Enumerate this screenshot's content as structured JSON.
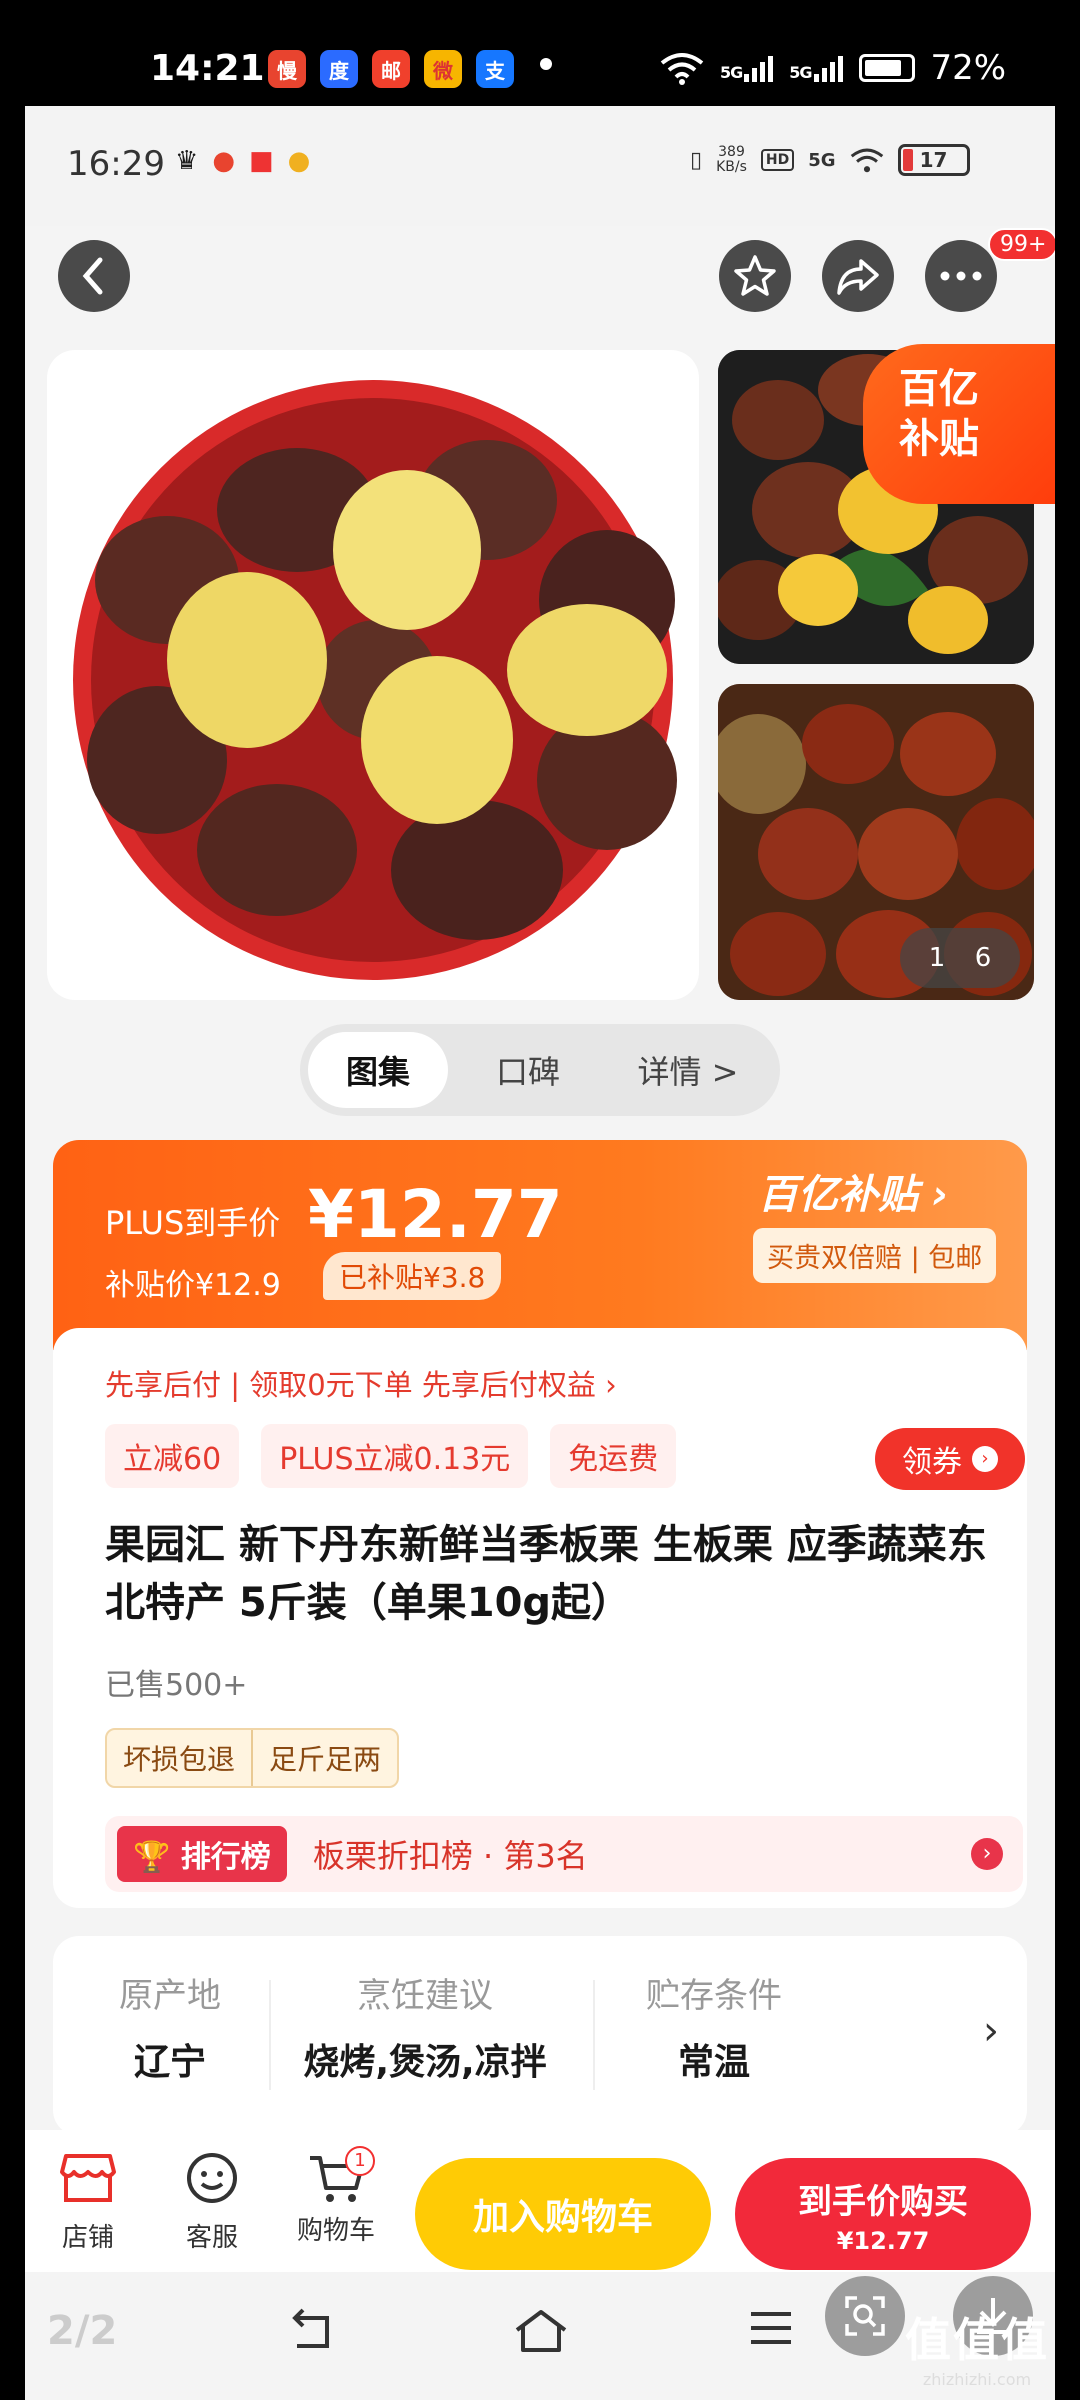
{
  "outer_status": {
    "time": "14:21",
    "apps": [
      "慢",
      "度",
      "邮",
      "微",
      "支"
    ],
    "signal1": "5G",
    "signal2": "5G",
    "battery": "72%"
  },
  "inner_status": {
    "time": "16:29",
    "speed": "389\nKB/s",
    "hd": "HD",
    "net": "5G",
    "battery": "17"
  },
  "header": {
    "notif_badge": "99+"
  },
  "gallery": {
    "subsidy_corner_line1": "百亿",
    "subsidy_corner_line2": "补贴",
    "counter_current": "1",
    "counter_total": "6"
  },
  "tabs": [
    {
      "label": "图集"
    },
    {
      "label": "口碑"
    },
    {
      "label": "详情 >"
    }
  ],
  "price": {
    "plus_label": "PLUS到手价",
    "plus_price": "¥12.77",
    "subsidy_price": "补贴价¥12.9",
    "subsidized": "已补贴¥3.8",
    "brand_logo": "百亿补贴 ›",
    "brand_tags": "买贵双倍赔 | 包邮"
  },
  "product": {
    "pay_later": "先享后付 | 领取0元下单 先享后付权益 ›",
    "promos": [
      "立减60",
      "PLUS立减0.13元",
      "免运费"
    ],
    "coupon": "领券",
    "title": "果园汇 新下丹东新鲜当季板栗 生板栗 应季蔬菜东北特产 5斤装（单果10g起）",
    "sold": "已售500+",
    "assurances": [
      "坏损包退",
      "足斤足两"
    ],
    "rank_tag": "🏆 排行榜",
    "rank_text": "板栗折扣榜 · 第3名"
  },
  "attributes": [
    {
      "key": "原产地",
      "value": "辽宁"
    },
    {
      "key": "烹饪建议",
      "value": "烧烤,煲汤,凉拌"
    },
    {
      "key": "贮存条件",
      "value": "常温"
    }
  ],
  "bottom_bar": {
    "shop": "店铺",
    "service": "客服",
    "cart": "购物车",
    "cart_count": "1",
    "add_cart": "加入购物车",
    "buy_main": "到手价购买",
    "buy_sub": "¥12.77"
  },
  "nav": {
    "page_indicator": "2/2"
  },
  "watermark": {
    "big": "值值值",
    "small": "zhizhizhi.com"
  },
  "colors": {
    "accent_orange": "#ff6214",
    "accent_red": "#f2293a",
    "accent_yellow": "#ffcb05"
  }
}
